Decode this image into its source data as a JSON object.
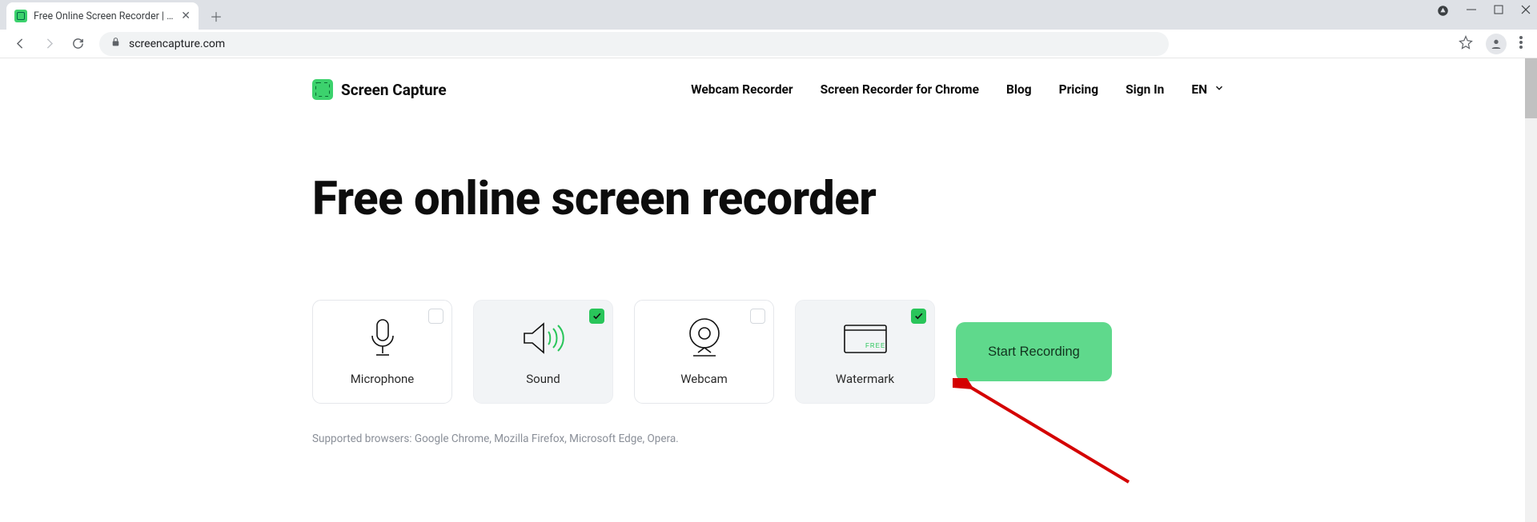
{
  "browser": {
    "tab_title": "Free Online Screen Recorder | Fre",
    "url": "screencapture.com"
  },
  "header": {
    "brand": "Screen Capture",
    "nav": {
      "webcam": "Webcam Recorder",
      "chrome": "Screen Recorder for Chrome",
      "blog": "Blog",
      "pricing": "Pricing",
      "signin": "Sign In",
      "lang": "EN"
    }
  },
  "hero": {
    "title": "Free online screen recorder"
  },
  "options": {
    "microphone": {
      "label": "Microphone",
      "checked": false
    },
    "sound": {
      "label": "Sound",
      "checked": true
    },
    "webcam": {
      "label": "Webcam",
      "checked": false
    },
    "watermark": {
      "label": "Watermark",
      "checked": true
    }
  },
  "cta": {
    "start": "Start Recording"
  },
  "supported": "Supported browsers: Google Chrome, Mozilla Firefox, Microsoft Edge, Opera."
}
